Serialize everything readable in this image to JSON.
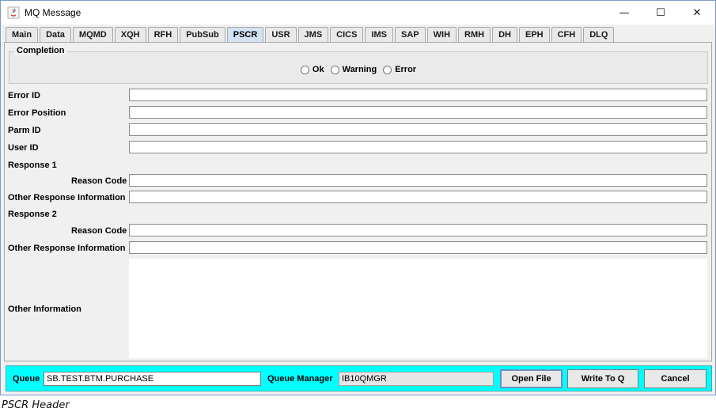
{
  "window": {
    "title": "MQ Message",
    "controls": {
      "minimize": "—",
      "maximize": "☐",
      "close": "✕"
    }
  },
  "tabs": [
    "Main",
    "Data",
    "MQMD",
    "XQH",
    "RFH",
    "PubSub",
    "PSCR",
    "USR",
    "JMS",
    "CICS",
    "IMS",
    "SAP",
    "WIH",
    "RMH",
    "DH",
    "EPH",
    "CFH",
    "DLQ"
  ],
  "active_tab": "PSCR",
  "completion": {
    "legend": "Completion",
    "options": [
      "Ok",
      "Warning",
      "Error"
    ]
  },
  "fields": {
    "error_id": "Error ID",
    "error_position": "Error Position",
    "parm_id": "Parm ID",
    "user_id": "User ID",
    "response1": "Response 1",
    "reason_code1": "Reason Code",
    "other_response1": "Other Response Information",
    "response2": "Response 2",
    "reason_code2": "Reason Code",
    "other_response2": "Other Response Information",
    "other_information": "Other Information"
  },
  "bottom": {
    "queue_label": "Queue",
    "queue_value": "SB.TEST.BTM.PURCHASE",
    "qm_label": "Queue Manager",
    "qm_value": "IB10QMGR",
    "open_file": "Open File",
    "write_to_q": "Write To Q",
    "cancel": "Cancel"
  },
  "caption": "PSCR Header",
  "colors": {
    "bottom_bar": "#00ffff",
    "active_tab": "#d3e3f3"
  }
}
